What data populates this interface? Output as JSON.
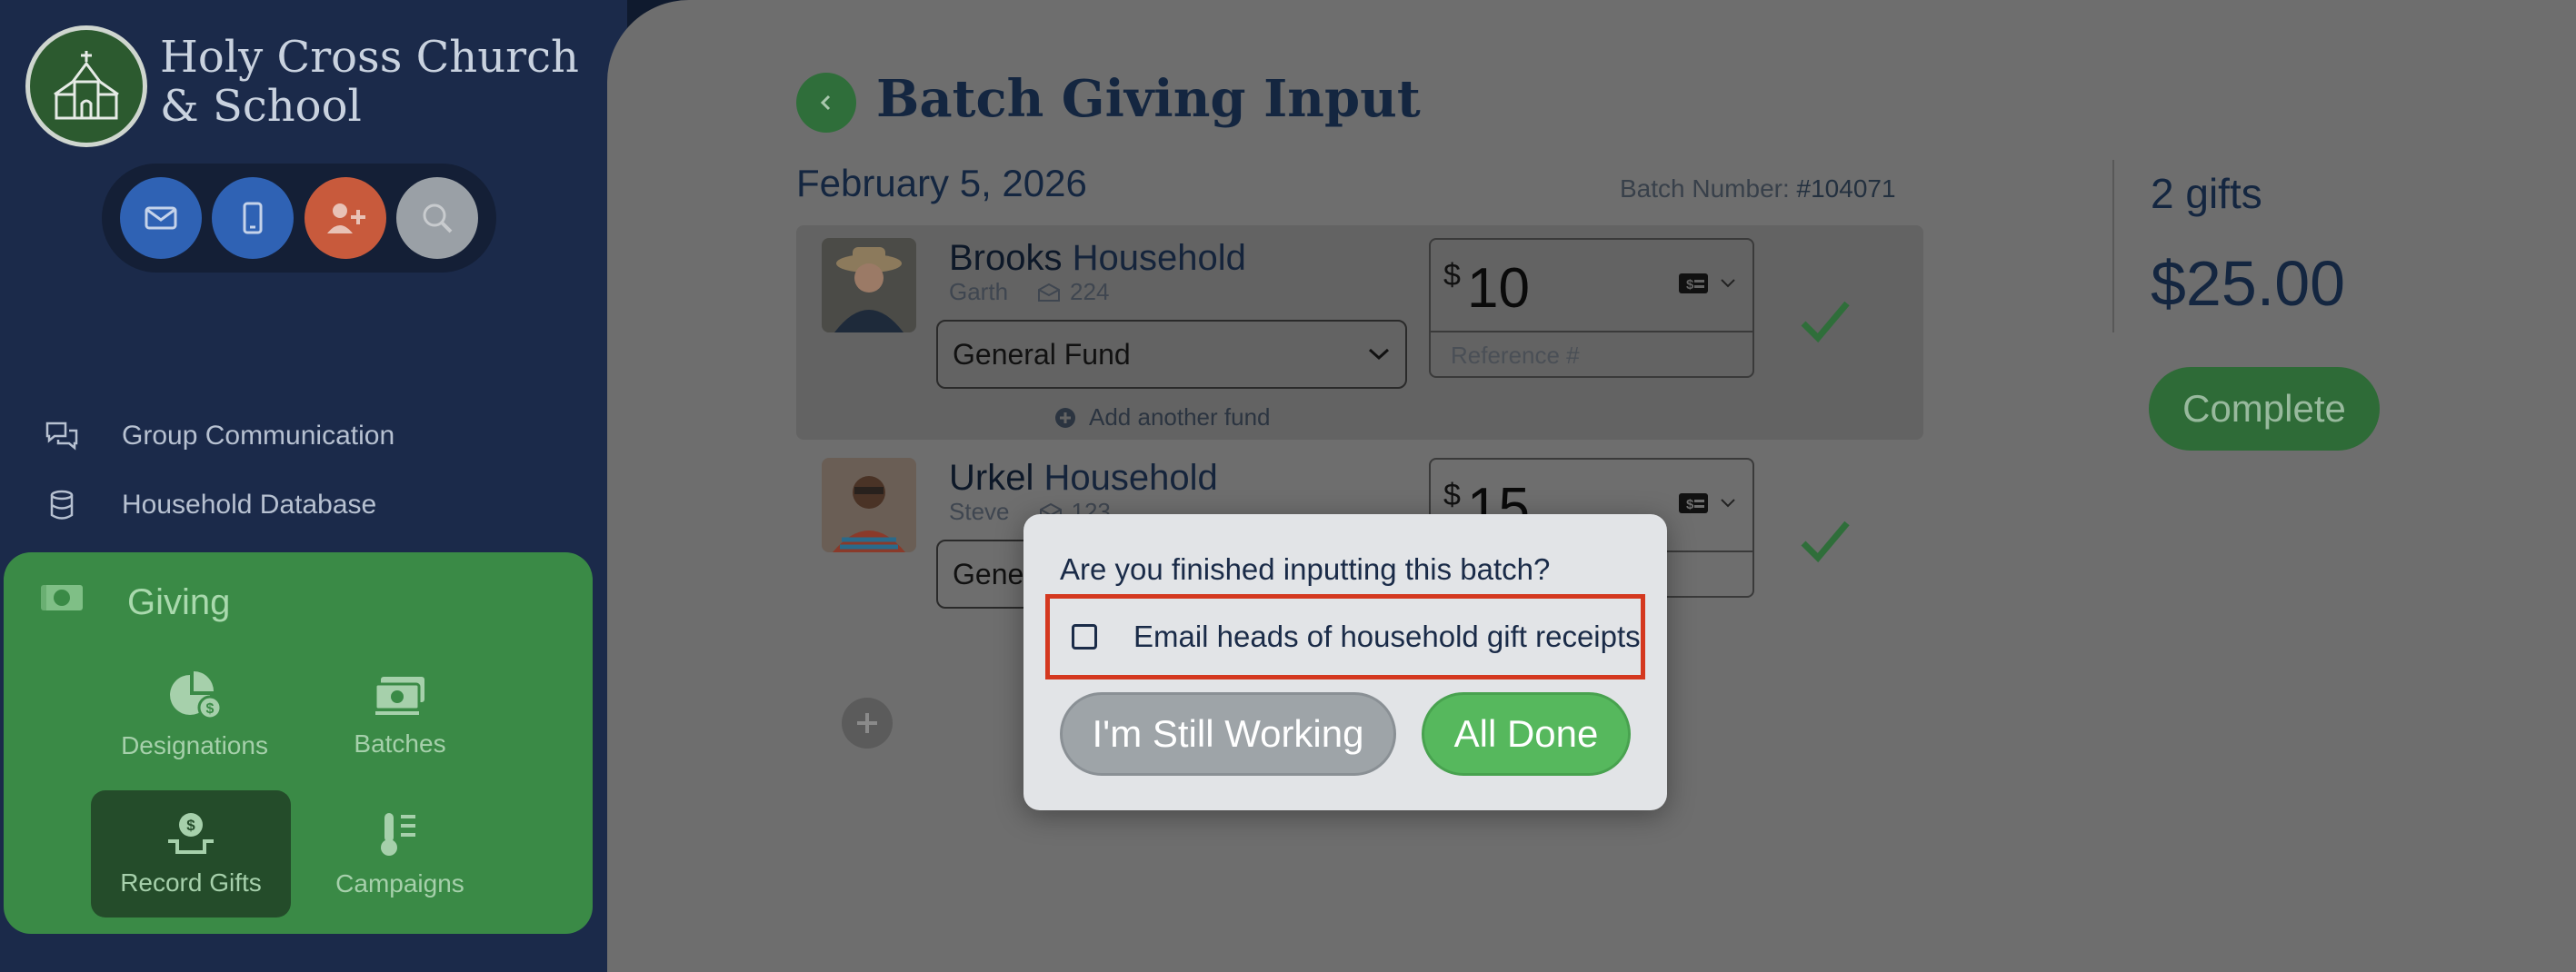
{
  "sidebar": {
    "church_name_line1": "Holy Cross Church",
    "church_name_line2": "& School",
    "quick_actions": [
      "email-icon",
      "phone-icon",
      "add-user-icon",
      "search-icon"
    ],
    "nav": [
      {
        "label": "Group Communication",
        "icon": "chat-icon"
      },
      {
        "label": "Household Database",
        "icon": "database-icon"
      }
    ],
    "giving": {
      "label": "Giving",
      "tiles": [
        {
          "label": "Designations",
          "icon": "pie-dollar-icon"
        },
        {
          "label": "Batches",
          "icon": "cash-stack-icon"
        },
        {
          "label": "Record Gifts",
          "icon": "hand-coin-icon",
          "active": true
        },
        {
          "label": "Campaigns",
          "icon": "thermometer-list-icon"
        }
      ]
    }
  },
  "header": {
    "title": "Batch Giving Input",
    "date": "February 5, 2026",
    "batch_label": "Batch Number:",
    "batch_number": "#104071"
  },
  "rows": [
    {
      "last_name": "Brooks",
      "suffix": "Household",
      "first_name": "Garth",
      "envelope": "224",
      "fund": "General Fund",
      "add_fund": "Add another fund",
      "currency": "$",
      "amount": "10",
      "reference_placeholder": "Reference #"
    },
    {
      "last_name": "Urkel",
      "suffix": "Household",
      "first_name": "Steve",
      "envelope": "123",
      "fund": "General Fund",
      "currency": "$",
      "amount": "15"
    }
  ],
  "summary": {
    "gift_count": "2 gifts",
    "total": "$25.00",
    "complete_label": "Complete"
  },
  "modal": {
    "question": "Are you finished inputting this batch?",
    "email_option": "Email heads of household gift receipts",
    "email_checked": false,
    "still_working_label": "I'm Still Working",
    "all_done_label": "All Done"
  },
  "colors": {
    "sidebar_bg": "#1b2a4a",
    "giving_bg": "#3a8a46",
    "overlay_main": "#6e6e6e",
    "highlight": "#d4381f",
    "done_green": "#56b85d"
  }
}
